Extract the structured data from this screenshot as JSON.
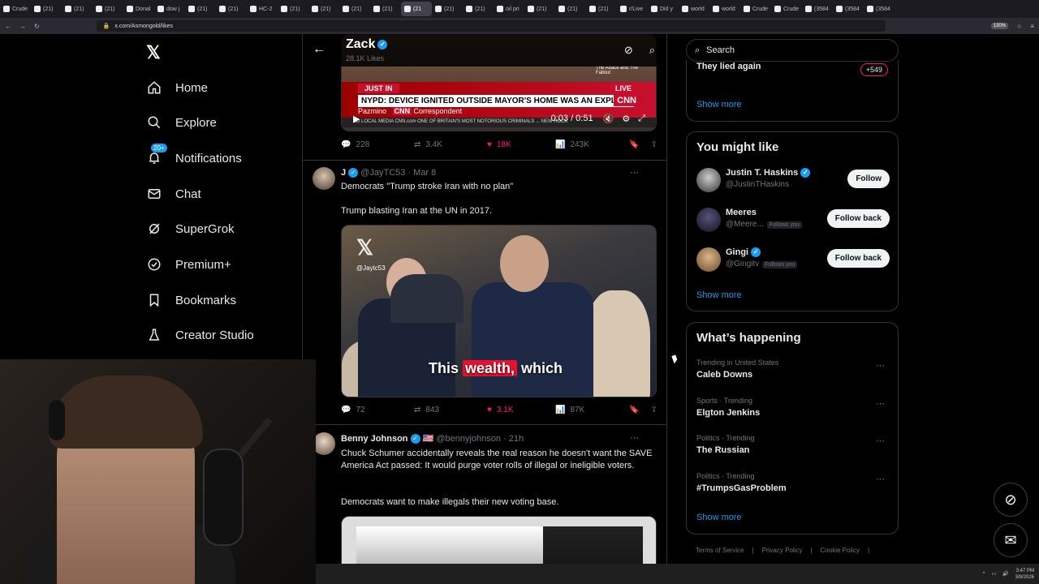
{
  "browser": {
    "tabs": [
      "Crude",
      "(21)",
      "(21)",
      "(21)",
      "Donal",
      "dow j",
      "(21)",
      "(21)",
      "HC-2",
      "(21)",
      "(21)",
      "(21)",
      "(21)",
      "(21)",
      "(21)",
      "(21)",
      "oil pri",
      "(21)",
      "(21)",
      "(21)",
      "r/Live",
      "Did y",
      "world",
      "world",
      "Crude",
      "Crude",
      "(3584",
      "(3584",
      "(3584"
    ],
    "active_tab_label": "(21",
    "url": "x.com/Asmongold/likes",
    "zoom": "130%"
  },
  "nav": {
    "items": [
      {
        "label": "Home",
        "icon": "home-icon"
      },
      {
        "label": "Explore",
        "icon": "search-icon"
      },
      {
        "label": "Notifications",
        "icon": "bell-icon"
      },
      {
        "label": "Chat",
        "icon": "mail-icon"
      },
      {
        "label": "SuperGrok",
        "icon": "grok-icon"
      },
      {
        "label": "Premium+",
        "icon": "verified-icon"
      },
      {
        "label": "Bookmarks",
        "icon": "bookmark-icon"
      },
      {
        "label": "Creator Studio",
        "icon": "flask-icon"
      }
    ],
    "notifications_badge": "20+"
  },
  "header": {
    "title": "Zack",
    "subtitle": "28.1K Likes"
  },
  "tweet1": {
    "video": {
      "just_in": "JUST IN",
      "live": "LIVE",
      "headline": "NYPD: DEVICE IGNITED OUTSIDE MAYOR'S HOME WAS AN EXPLOSIVE DEVICE",
      "reporter": "Pazmino",
      "network": "CNN",
      "reporter_role": "Correspondent",
      "ticker": "ED LOCAL MEDIA     CNN.com     ONE OF BRITAIN'S MOST NOTORIOUS CRIMINALS ... NEW ROCK",
      "time": "0:03 / 0:51",
      "top_right": "The Attack and The Fallout"
    },
    "replies": "228",
    "reposts": "3.4K",
    "likes": "18K",
    "views": "243K"
  },
  "tweet2": {
    "name": "J",
    "handle": "@JayTC53",
    "date": "Mar 8",
    "text1": "Democrats \"Trump stroke Iran with no plan\"",
    "text2": "Trump blasting Iran at the UN in 2017.",
    "watermark_handle": "@Jaytc53",
    "caption_before": "This ",
    "caption_highlight": "wealth,",
    "caption_after": " which",
    "replies": "72",
    "reposts": "843",
    "likes": "3.1K",
    "views": "87K"
  },
  "tweet3": {
    "name": "Benny Johnson",
    "handle": "@bennyjohnson",
    "date": "21h",
    "text1": "Chuck Schumer accidentally reveals the real reason he doesn't want the SAVE America Act passed: It would purge voter rolls of illegal or ineligible voters.",
    "text2": "Democrats want to make illegals their new voting base."
  },
  "right": {
    "search_placeholder": "Search",
    "top_box": {
      "partial_text": "They lied again",
      "count": "+549",
      "show_more": "Show more"
    },
    "who_to_follow": {
      "title": "You might like",
      "people": [
        {
          "name": "Justin T. Haskins",
          "handle": "@JustinTHaskins",
          "verified": true,
          "follows_you": "",
          "button": "Follow"
        },
        {
          "name": "Meeres",
          "handle": "@Meere...",
          "verified": false,
          "follows_you": "Follows you",
          "button": "Follow back"
        },
        {
          "name": "Gingi",
          "handle": "@Gingitv",
          "verified": true,
          "follows_you": "Follows you",
          "button": "Follow back"
        }
      ],
      "show_more": "Show more"
    },
    "trends": {
      "title": "What’s happening",
      "items": [
        {
          "category": "Trending in United States",
          "topic": "Caleb Downs"
        },
        {
          "category": "Sports · Trending",
          "topic": "Elgton Jenkins"
        },
        {
          "category": "Politics · Trending",
          "topic": "The Russian"
        },
        {
          "category": "Politics · Trending",
          "topic": "#TrumpsGasProblem"
        }
      ],
      "show_more": "Show more"
    },
    "footer": [
      "Terms of Service",
      "Privacy Policy",
      "Cookie Policy"
    ]
  },
  "taskbar": {
    "time": "3:47 PM",
    "date": "3/9/2026"
  },
  "colors": {
    "accent": "#1d9bf0",
    "like": "#f91880",
    "border": "#2f3336",
    "muted": "#71767b"
  }
}
